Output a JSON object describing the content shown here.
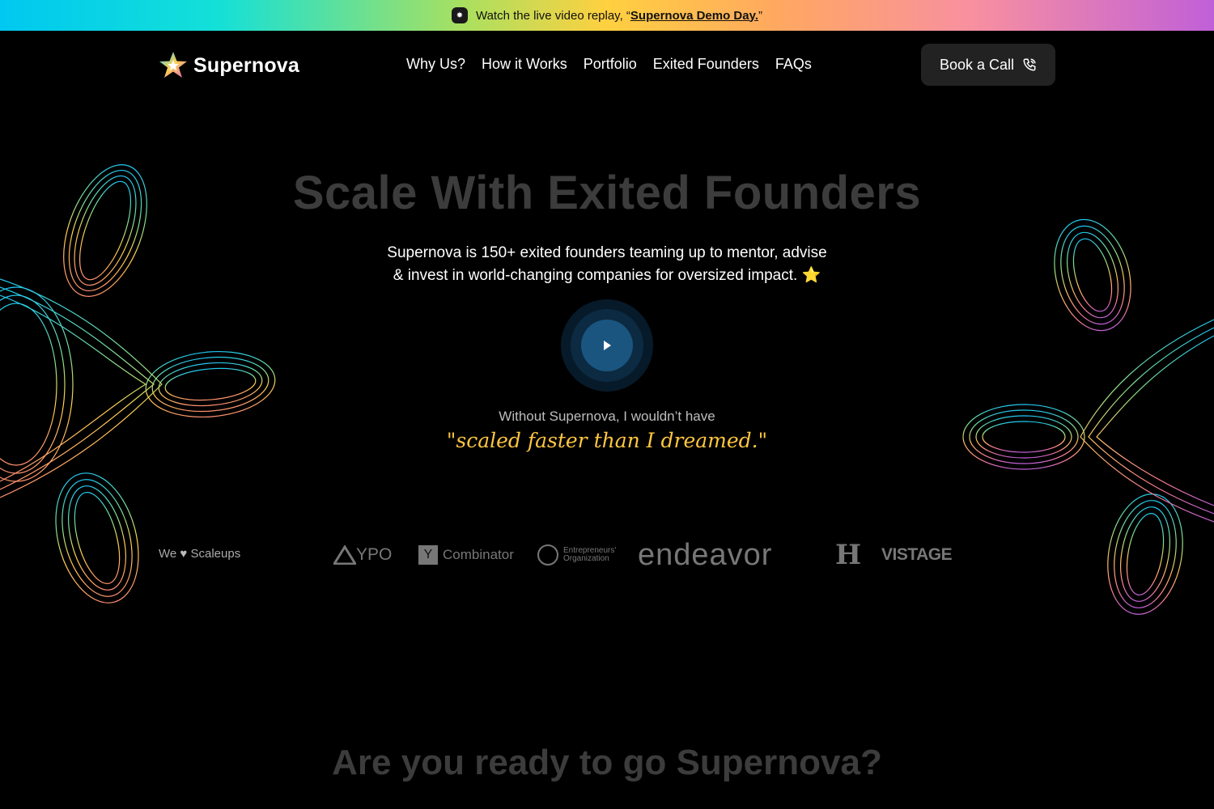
{
  "banner": {
    "text": "Watch the live video replay, “",
    "link": "Supernova Demo Day.",
    "suffix": "”"
  },
  "brand": {
    "name": "Supernova"
  },
  "nav": {
    "links": [
      "Why Us?",
      "How it Works",
      "Portfolio",
      "Exited Founders",
      "FAQs"
    ],
    "cta": "Book a Call"
  },
  "hero": {
    "title": "Scale With Exited Founders",
    "subtitle_line1": "Supernova is 150+ exited founders teaming up to mentor, advise",
    "subtitle_line2": "& invest in world-changing companies for oversized impact. ⭐",
    "quote_lead": "Without Supernova, I wouldn’t have",
    "quote_main": "\"scaled faster than I dreamed.\""
  },
  "logos": {
    "label_prefix": "We",
    "label_suffix": "Scaleups",
    "items": [
      "YPO",
      "Combinator",
      "Entrepreneurs' Organization",
      "endeavor",
      "H",
      "VISTAGE"
    ]
  },
  "bottom": {
    "title": "Are you ready to go Supernova?"
  },
  "colors": {
    "background": "#000000",
    "quote_accent": "#ffc640",
    "cta_bg": "#222222"
  }
}
